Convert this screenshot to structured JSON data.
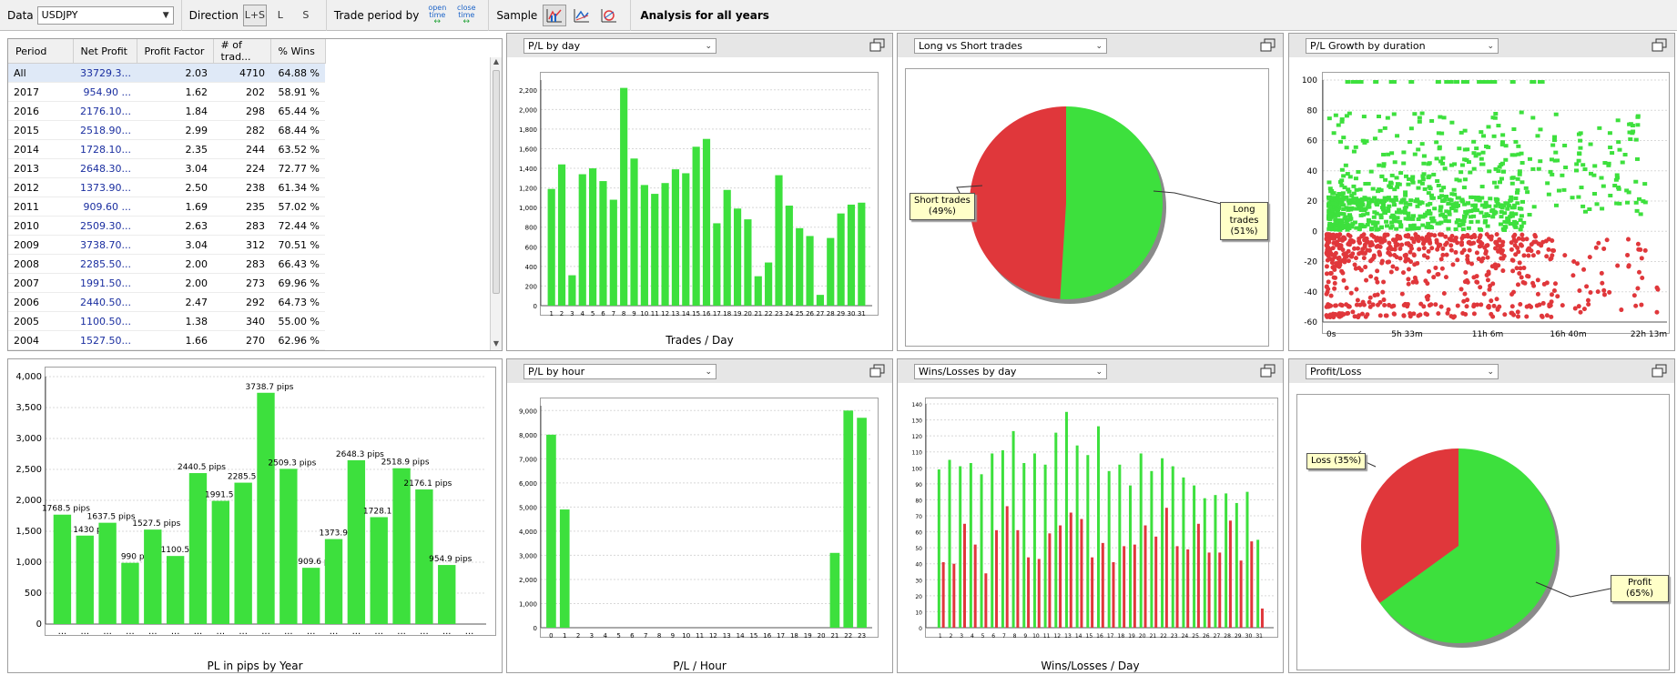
{
  "toolbar": {
    "data_label": "Data",
    "data_value": "USDJPY",
    "direction_label": "Direction",
    "dir_options": [
      "L+S",
      "L",
      "S"
    ],
    "trade_period_label": "Trade period by",
    "open_time_label": "open time",
    "close_time_label": "close time",
    "sample_label": "Sample",
    "analysis_title": "Analysis for all years"
  },
  "table": {
    "headers": [
      "Period",
      "Net Profit",
      "Profit Factor",
      "# of trad...",
      "% Wins"
    ],
    "rows": [
      [
        "All",
        "33729.3...",
        "2.03",
        "4710",
        "64.88 %"
      ],
      [
        "2017",
        "954.90 ...",
        "1.62",
        "202",
        "58.91 %"
      ],
      [
        "2016",
        "2176.10...",
        "1.84",
        "298",
        "65.44 %"
      ],
      [
        "2015",
        "2518.90...",
        "2.99",
        "282",
        "68.44 %"
      ],
      [
        "2014",
        "1728.10...",
        "2.35",
        "244",
        "63.52 %"
      ],
      [
        "2013",
        "2648.30...",
        "3.04",
        "224",
        "72.77 %"
      ],
      [
        "2012",
        "1373.90...",
        "2.50",
        "238",
        "61.34 %"
      ],
      [
        "2011",
        "909.60 ...",
        "1.69",
        "235",
        "57.02 %"
      ],
      [
        "2010",
        "2509.30...",
        "2.63",
        "283",
        "72.44 %"
      ],
      [
        "2009",
        "3738.70...",
        "3.04",
        "312",
        "70.51 %"
      ],
      [
        "2008",
        "2285.50...",
        "2.00",
        "283",
        "66.43 %"
      ],
      [
        "2007",
        "1991.50...",
        "2.00",
        "273",
        "69.96 %"
      ],
      [
        "2006",
        "2440.50...",
        "2.47",
        "292",
        "64.73 %"
      ],
      [
        "2005",
        "1100.50...",
        "1.38",
        "340",
        "55.00 %"
      ],
      [
        "2004",
        "1527.50...",
        "1.66",
        "270",
        "62.96 %"
      ]
    ]
  },
  "panels": {
    "pl_day": {
      "selector": "P/L by day"
    },
    "long_short": {
      "selector": "Long vs Short trades"
    },
    "growth": {
      "selector": "P/L Growth by duration"
    },
    "pl_hour": {
      "selector": "P/L by hour"
    },
    "winloss": {
      "selector": "Wins/Losses by day"
    },
    "profit_loss": {
      "selector": "Profit/Loss"
    }
  },
  "colors": {
    "green": "#3de03d",
    "red": "#e0373b",
    "link": "#1a2ea0"
  },
  "chart_data": [
    {
      "id": "pl_year",
      "type": "bar",
      "xlabel": "PL in pips by Year",
      "ylim": [
        0,
        4000
      ],
      "yticks": [
        "0",
        "500",
        "1,000",
        "1,500",
        "2,000",
        "2,500",
        "3,000",
        "3,500",
        "4,000"
      ],
      "categories": [
        "...",
        "...",
        "...",
        "...",
        "...",
        "...",
        "...",
        "...",
        "...",
        "...",
        "...",
        "...",
        "...",
        "...",
        "...",
        "...",
        "...",
        "...",
        "..."
      ],
      "values": [
        1768.5,
        1430,
        1637.5,
        990,
        1527.5,
        1100.5,
        2440.5,
        1991.5,
        2285.5,
        3738.7,
        2509.3,
        909.6,
        1373.9,
        2648.3,
        1728.1,
        2518.9,
        2176.1,
        954.9
      ],
      "labels": [
        "1768.5 pips",
        "1430 pi",
        "1637.5 pips",
        "990 pi",
        "1527.5 pips",
        "1100.5 p",
        "2440.5 pips",
        "1991.5 pi",
        "2285.5 pi",
        "3738.7 pips",
        "2509.3 pips",
        "909.6 pi",
        "1373.9 p",
        "2648.3 pips",
        "1728.1 pi",
        "2518.9 pips",
        "2176.1 pips",
        "954.9 pips"
      ]
    },
    {
      "id": "pl_day",
      "type": "bar",
      "xlabel": "Trades / Day",
      "ylim": [
        0,
        2300
      ],
      "yticks": [
        "0",
        "200",
        "400",
        "600",
        "800",
        "1,000",
        "1,200",
        "1,400",
        "1,600",
        "1,800",
        "2,000",
        "2,200"
      ],
      "categories": [
        "1",
        "2",
        "3",
        "4",
        "5",
        "6",
        "7",
        "8",
        "9",
        "10",
        "11",
        "12",
        "13",
        "14",
        "15",
        "16",
        "17",
        "18",
        "19",
        "20",
        "21",
        "22",
        "23",
        "24",
        "25",
        "26",
        "27",
        "28",
        "29",
        "30",
        "31"
      ],
      "values": [
        1190,
        1440,
        310,
        1340,
        1400,
        1270,
        1080,
        2220,
        1500,
        1230,
        1140,
        1250,
        1390,
        1350,
        1620,
        1700,
        840,
        1180,
        990,
        880,
        300,
        440,
        1330,
        1020,
        790,
        710,
        110,
        690,
        940,
        1030,
        1050
      ]
    },
    {
      "id": "long_short",
      "type": "pie",
      "slices": [
        {
          "label": "Long trades",
          "pct_label": "(51%)",
          "value": 51
        },
        {
          "label": "Short trades",
          "pct_label": "(49%)",
          "value": 49
        }
      ]
    },
    {
      "id": "growth",
      "type": "scatter",
      "ylim": [
        -60,
        100
      ],
      "yticks": [
        "-60",
        "-40",
        "-20",
        "0",
        "20",
        "40",
        "60",
        "80",
        "100"
      ],
      "xticks": [
        "0s",
        "5h 33m",
        "11h 6m",
        "16h 40m",
        "22h 13m"
      ]
    },
    {
      "id": "pl_hour",
      "type": "bar",
      "xlabel": "P/L / Hour",
      "ylim": [
        0,
        9200
      ],
      "yticks": [
        "0",
        "1,000",
        "2,000",
        "3,000",
        "4,000",
        "5,000",
        "6,000",
        "7,000",
        "8,000",
        "9,000"
      ],
      "categories": [
        "0",
        "1",
        "2",
        "3",
        "4",
        "5",
        "6",
        "7",
        "8",
        "9",
        "10",
        "11",
        "12",
        "13",
        "14",
        "15",
        "16",
        "17",
        "18",
        "19",
        "20",
        "21",
        "22",
        "23"
      ],
      "values": [
        8000,
        4900,
        0,
        0,
        0,
        0,
        0,
        0,
        0,
        0,
        0,
        0,
        0,
        0,
        0,
        0,
        0,
        0,
        0,
        0,
        0,
        3100,
        9000,
        8700
      ]
    },
    {
      "id": "winloss",
      "type": "bar",
      "xlabel": "Wins/Losses / Day",
      "ylim": [
        0,
        140
      ],
      "yticks": [
        "0",
        "10",
        "20",
        "30",
        "40",
        "50",
        "60",
        "70",
        "80",
        "90",
        "100",
        "110",
        "120",
        "130",
        "140"
      ],
      "categories": [
        "1",
        "2",
        "3",
        "4",
        "5",
        "6",
        "7",
        "8",
        "9",
        "10",
        "11",
        "12",
        "13",
        "14",
        "15",
        "16",
        "17",
        "18",
        "19",
        "20",
        "21",
        "22",
        "23",
        "24",
        "25",
        "26",
        "27",
        "28",
        "29",
        "30",
        "31"
      ],
      "series": [
        {
          "name": "",
          "values": [
            99,
            105,
            101,
            103,
            96,
            109,
            111,
            123,
            103,
            109,
            102,
            122,
            135,
            114,
            108,
            126,
            98,
            102,
            89,
            109,
            98,
            106,
            101,
            94,
            89,
            81,
            83,
            84,
            78,
            85,
            55
          ]
        },
        {
          "name": "",
          "values": [
            41,
            40,
            65,
            52,
            34,
            61,
            76,
            61,
            44,
            43,
            59,
            64,
            72,
            68,
            44,
            53,
            41,
            51,
            52,
            64,
            57,
            75,
            51,
            49,
            65,
            47,
            47,
            67,
            42,
            54,
            12
          ]
        }
      ]
    },
    {
      "id": "profit_loss",
      "type": "pie",
      "slices": [
        {
          "label": "Profit",
          "pct_label": "(65%)",
          "value": 65
        },
        {
          "label": "Loss",
          "pct_label": "(35%)",
          "value": 35
        }
      ]
    }
  ]
}
